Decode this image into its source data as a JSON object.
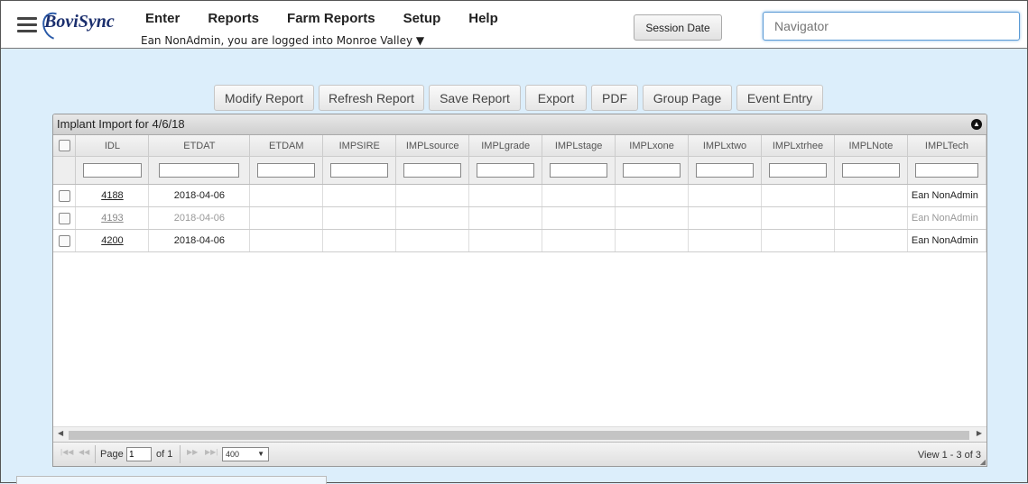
{
  "app": {
    "brand": "BoviSync"
  },
  "menu": [
    "Enter",
    "Reports",
    "Farm Reports",
    "Setup",
    "Help"
  ],
  "login": {
    "text": "Ean NonAdmin, you are logged into Monroe Valley ▼"
  },
  "header": {
    "session_label": "Session Date",
    "navigator_placeholder": "Navigator"
  },
  "toolbar": [
    {
      "label": "Modify Report",
      "w": 111
    },
    {
      "label": "Refresh Report",
      "w": 117
    },
    {
      "label": "Save Report",
      "w": 102
    },
    {
      "label": "Export",
      "w": 68
    },
    {
      "label": "PDF",
      "w": 52
    },
    {
      "label": "Group Page",
      "w": 99
    },
    {
      "label": "Event Entry",
      "w": 96
    }
  ],
  "grid": {
    "caption": "Implant Import for 4/6/18",
    "columns": [
      "",
      "IDL",
      "ETDAT",
      "ETDAM",
      "IMPSIRE",
      "IMPLsource",
      "IMPLgrade",
      "IMPLstage",
      "IMPLxone",
      "IMPLxtwo",
      "IMPLxtrhee",
      "IMPLNote",
      "IMPLTech"
    ],
    "rows": [
      {
        "idl": "4188",
        "etdat": "2018-04-06",
        "tech": "Ean NonAdmin",
        "dim": false
      },
      {
        "idl": "4193",
        "etdat": "2018-04-06",
        "tech": "Ean NonAdmin",
        "dim": true
      },
      {
        "idl": "4200",
        "etdat": "2018-04-06",
        "tech": "Ean NonAdmin",
        "dim": false
      }
    ]
  },
  "pager": {
    "page_label": "Page",
    "page_value": "1",
    "of_label": "of 1",
    "rows_per_page": "400",
    "view_text": "View 1 - 3 of 3"
  }
}
